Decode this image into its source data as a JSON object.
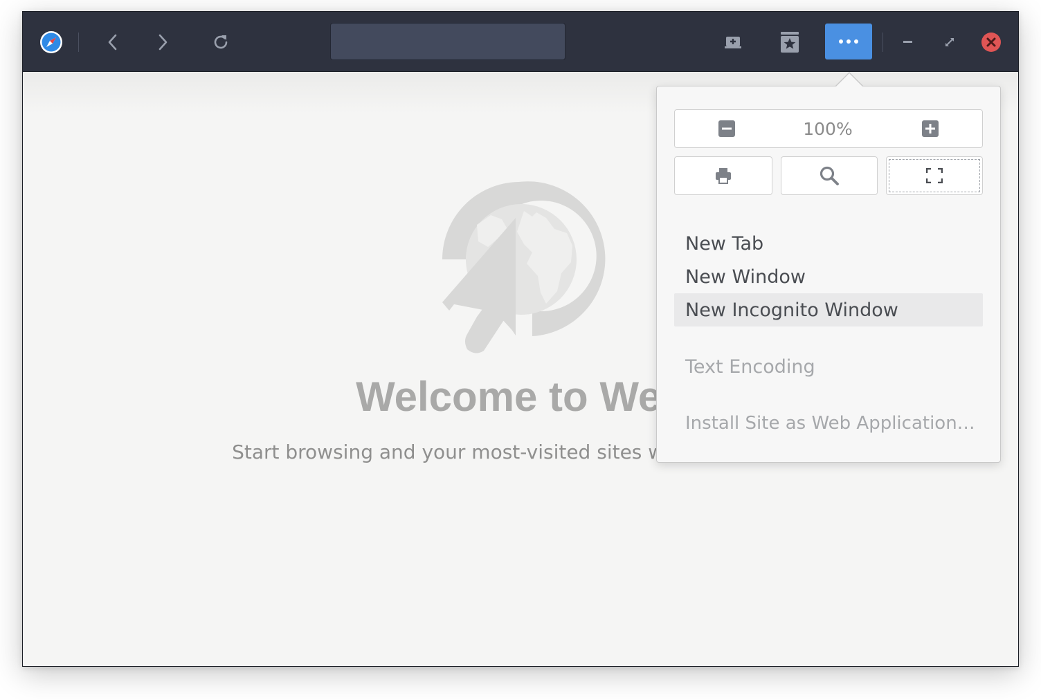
{
  "headerbar": {
    "app_icon": "compass-icon",
    "back_icon": "chevron-left-icon",
    "forward_icon": "chevron-right-icon",
    "reload_icon": "reload-icon",
    "url_value": "",
    "new_tab_icon": "new-tab-icon",
    "bookmarks_icon": "bookmark-star-icon",
    "menu_icon": "more-dots-icon",
    "minimize_icon": "minimize-icon",
    "maximize_icon": "maximize-icon",
    "close_icon": "close-icon",
    "colors": {
      "background": "#2e323f",
      "accent": "#4a90e2",
      "close": "#e05555"
    }
  },
  "welcome": {
    "title": "Welcome to Web",
    "subtitle": "Start browsing and your most-visited sites will appear here."
  },
  "popover": {
    "zoom_out_icon": "zoom-out-icon",
    "zoom_level": "100%",
    "zoom_in_icon": "zoom-in-icon",
    "print_icon": "print-icon",
    "find_icon": "search-icon",
    "fullscreen_icon": "fullscreen-icon",
    "items": [
      {
        "label": "New Tab",
        "state": "normal"
      },
      {
        "label": "New Window",
        "state": "normal"
      },
      {
        "label": "New Incognito Window",
        "state": "hover"
      },
      {
        "label": "Text Encoding",
        "state": "disabled"
      },
      {
        "label": "Install Site as Web Application…",
        "state": "disabled"
      }
    ]
  }
}
